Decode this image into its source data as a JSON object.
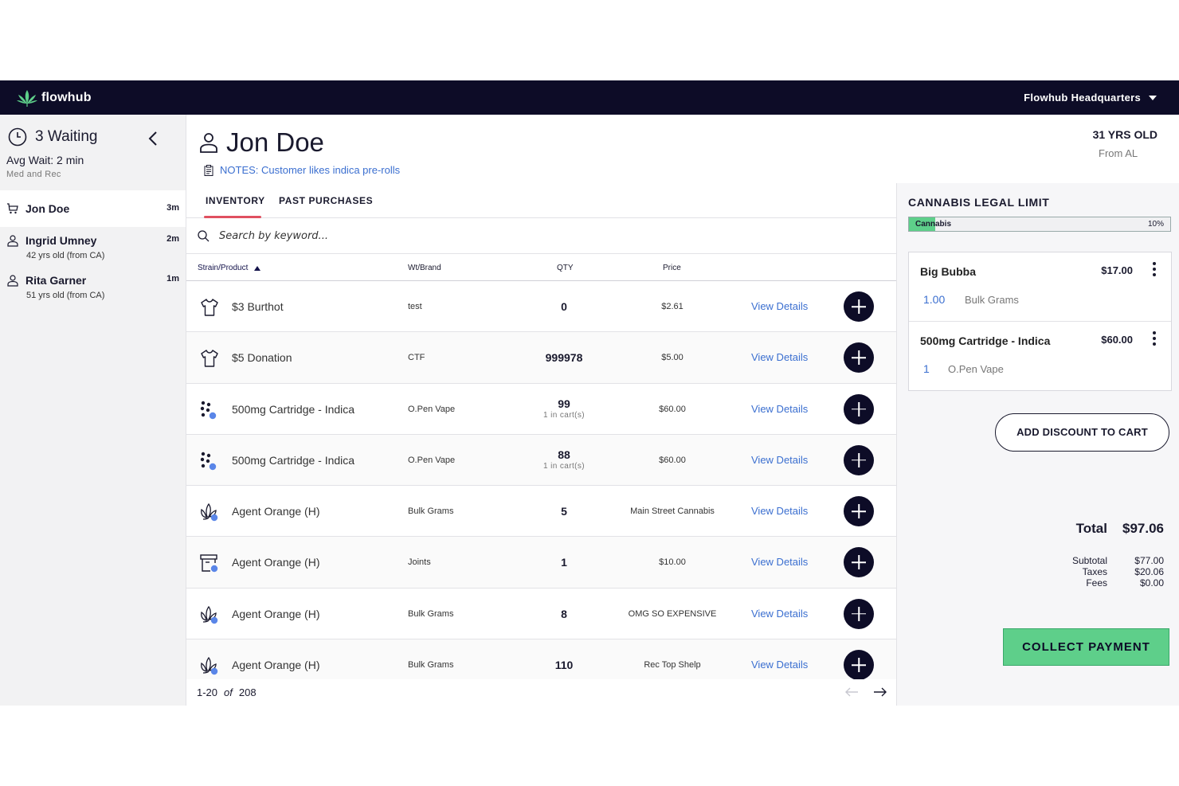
{
  "topbar": {
    "brand": "flowhub",
    "store": "Flowhub Headquarters"
  },
  "queue": {
    "waiting_count": "3 Waiting",
    "avg_wait": "Avg Wait:  2 min",
    "type": "Med and Rec",
    "customers": [
      {
        "name": "Jon Doe",
        "time": "3m",
        "sub": "",
        "icon": "cart-icon",
        "active": true
      },
      {
        "name": "Ingrid Umney",
        "time": "2m",
        "sub": "42 yrs old (from CA)",
        "icon": "person-icon",
        "active": false
      },
      {
        "name": "Rita Garner",
        "time": "1m",
        "sub": "51 yrs old (from CA)",
        "icon": "person-icon",
        "active": false
      }
    ]
  },
  "customer": {
    "name": "Jon Doe",
    "notes": "NOTES: Customer likes indica pre-rolls",
    "age": "31 YRS OLD",
    "from": "From AL"
  },
  "tabs": [
    "INVENTORY",
    "PAST PURCHASES"
  ],
  "search": {
    "placeholder": "Search by keyword..."
  },
  "table": {
    "columns": [
      "Strain/Product",
      "Wt/Brand",
      "QTY",
      "Price"
    ],
    "view_label": "View Details",
    "rows": [
      {
        "icon": "shirt-icon",
        "product": "$3 Burthot",
        "brand": "test",
        "qty": "0",
        "in_cart": "",
        "price": "$2.61"
      },
      {
        "icon": "shirt-icon",
        "product": "$5 Donation",
        "brand": "CTF",
        "qty": "999978",
        "in_cart": "",
        "price": "$5.00"
      },
      {
        "icon": "dots-cartridge-icon",
        "product": "500mg Cartridge - Indica",
        "brand": "O.Pen Vape",
        "qty": "99",
        "in_cart": "1 in cart(s)",
        "price": "$60.00"
      },
      {
        "icon": "dots-cartridge-icon",
        "product": "500mg Cartridge - Indica",
        "brand": "O.Pen Vape",
        "qty": "88",
        "in_cart": "1 in cart(s)",
        "price": "$60.00"
      },
      {
        "icon": "flower-icon",
        "product": "Agent Orange (H)",
        "brand": "Bulk Grams",
        "qty": "5",
        "in_cart": "",
        "price": "Main Street Cannabis"
      },
      {
        "icon": "box-icon",
        "product": "Agent Orange (H)",
        "brand": "Joints",
        "qty": "1",
        "in_cart": "",
        "price": "$10.00"
      },
      {
        "icon": "flower-icon",
        "product": "Agent Orange (H)",
        "brand": "Bulk Grams",
        "qty": "8",
        "in_cart": "",
        "price": "OMG SO EXPENSIVE"
      },
      {
        "icon": "flower-icon",
        "product": "Agent Orange (H)",
        "brand": "Bulk Grams",
        "qty": "110",
        "in_cart": "",
        "price": "Rec Top Shelp"
      }
    ]
  },
  "pagination": {
    "range": "1-20",
    "of": "of",
    "total": "208"
  },
  "legal_limit": {
    "title": "CANNABIS LEGAL LIMIT",
    "category": "Cannabis",
    "percent_label": "10%",
    "fraction": 0.1
  },
  "cart": {
    "items": [
      {
        "name": "Big Bubba",
        "price": "$17.00",
        "qty": "1.00",
        "unit": "Bulk Grams"
      },
      {
        "name": "500mg Cartridge - Indica",
        "price": "$60.00",
        "qty": "1",
        "unit": "O.Pen Vape"
      }
    ],
    "discount_label": "ADD DISCOUNT TO CART",
    "subtotal_label": "Subtotal",
    "subtotal": "$77.00",
    "taxes_label": "Taxes",
    "taxes": "$20.06",
    "fees_label": "Fees",
    "fees": "$0.00",
    "total_label": "Total",
    "total": "$97.06",
    "collect_label": "COLLECT PAYMENT"
  },
  "colors": {
    "nav_bg": "#0d0c27",
    "accent_blue": "#3b6fd0",
    "tab_underline": "#e05060",
    "collect_green": "#5ecf8a"
  }
}
